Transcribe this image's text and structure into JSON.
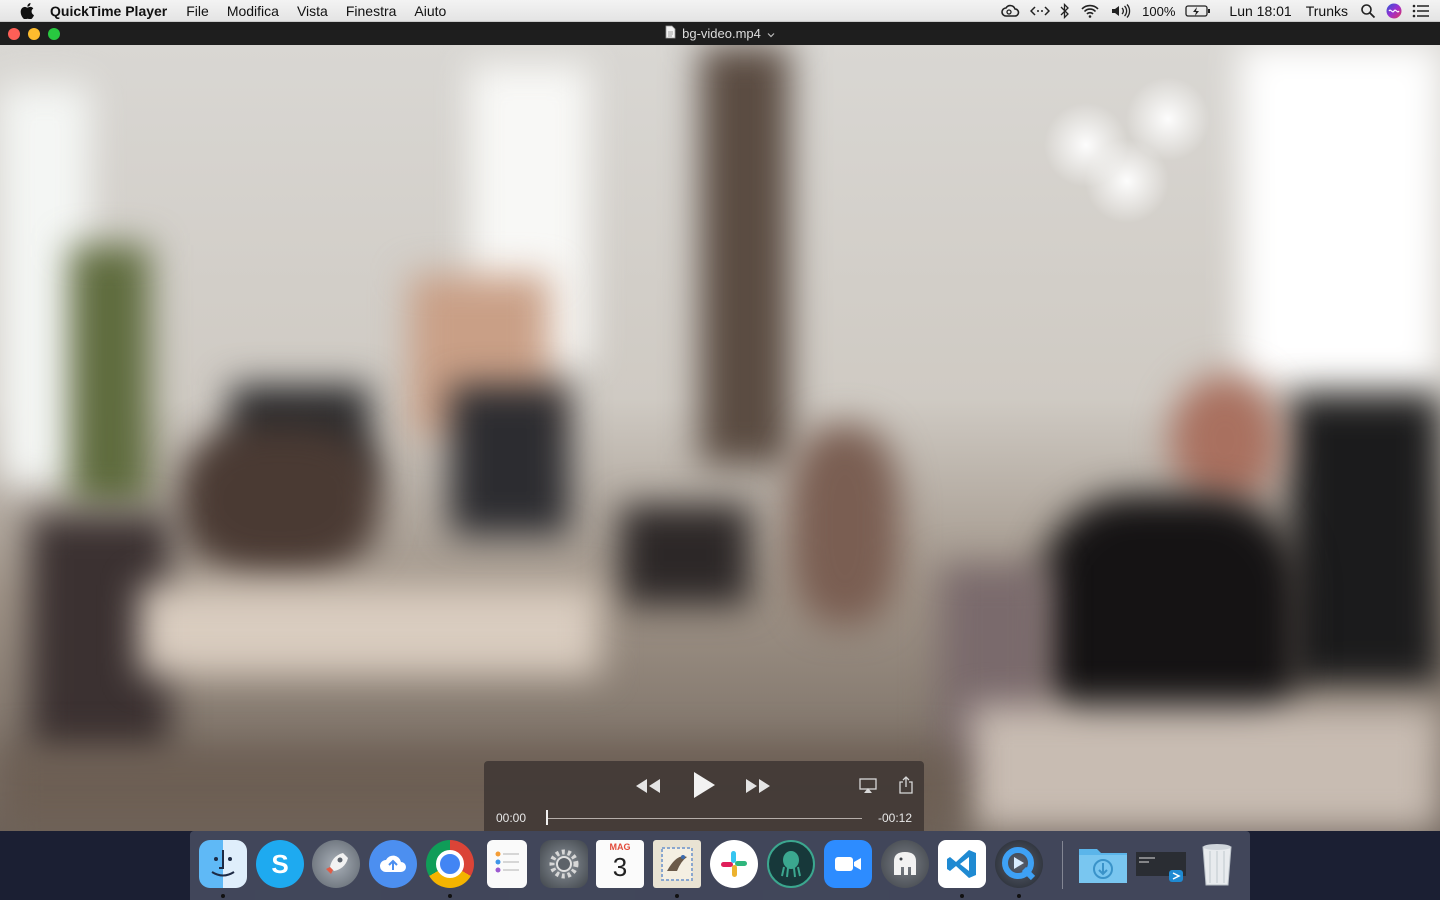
{
  "menubar": {
    "app_name": "QuickTime Player",
    "menus": [
      "File",
      "Modifica",
      "Vista",
      "Finestra",
      "Aiuto"
    ],
    "battery_percent": "100%",
    "clock": "Lun 18:01",
    "user": "Trunks",
    "status_icons": [
      "creative-cloud-icon",
      "code-brackets-icon",
      "bluetooth-icon",
      "wifi-icon",
      "volume-icon",
      "battery-charging-icon",
      "spotlight-search-icon",
      "siri-icon",
      "notification-center-icon"
    ]
  },
  "window": {
    "title": "bg-video.mp4",
    "controls": [
      "close",
      "minimize",
      "zoom"
    ]
  },
  "player": {
    "time_current": "00:00",
    "time_remaining": "-00:12",
    "progress": 0.0,
    "buttons": [
      "rewind-icon",
      "play-icon",
      "fast-forward-icon",
      "airplay-icon",
      "share-icon"
    ]
  },
  "dock": {
    "apps": [
      {
        "name": "Finder",
        "icon": "finder-icon",
        "running": true
      },
      {
        "name": "Skype",
        "icon": "skype-icon",
        "running": false
      },
      {
        "name": "Launchpad",
        "icon": "launchpad-icon",
        "running": false
      },
      {
        "name": "Cloud Upload",
        "icon": "cloud-upload-icon",
        "running": false
      },
      {
        "name": "Chrome",
        "icon": "chrome-icon",
        "running": true
      },
      {
        "name": "Promemoria",
        "icon": "reminders-icon",
        "running": false
      },
      {
        "name": "Preferenze di Sistema",
        "icon": "system-preferences-icon",
        "running": false
      },
      {
        "name": "Calendario",
        "icon": "calendar-icon",
        "running": false,
        "month": "MAG",
        "day": "3"
      },
      {
        "name": "Mail",
        "icon": "mail-icon",
        "running": true
      },
      {
        "name": "Slack",
        "icon": "slack-icon",
        "running": false
      },
      {
        "name": "GitKraken",
        "icon": "gitkraken-icon",
        "running": false
      },
      {
        "name": "Zoom",
        "icon": "zoom-icon",
        "running": false
      },
      {
        "name": "TablePlus",
        "icon": "elephant-icon",
        "running": false
      },
      {
        "name": "Visual Studio Code",
        "icon": "vscode-icon",
        "running": true
      },
      {
        "name": "QuickTime Player",
        "icon": "quicktime-icon",
        "running": true
      },
      {
        "name": "Download",
        "icon": "downloads-folder-icon",
        "running": false
      },
      {
        "name": "Recent window",
        "icon": "minimized-window-icon",
        "running": false
      },
      {
        "name": "Cestino",
        "icon": "trash-icon",
        "running": false
      }
    ]
  },
  "colors": {
    "close": "#fe5f57",
    "minimize": "#febc2e",
    "zoom": "#28c840",
    "hud_background": "#3c3432"
  }
}
